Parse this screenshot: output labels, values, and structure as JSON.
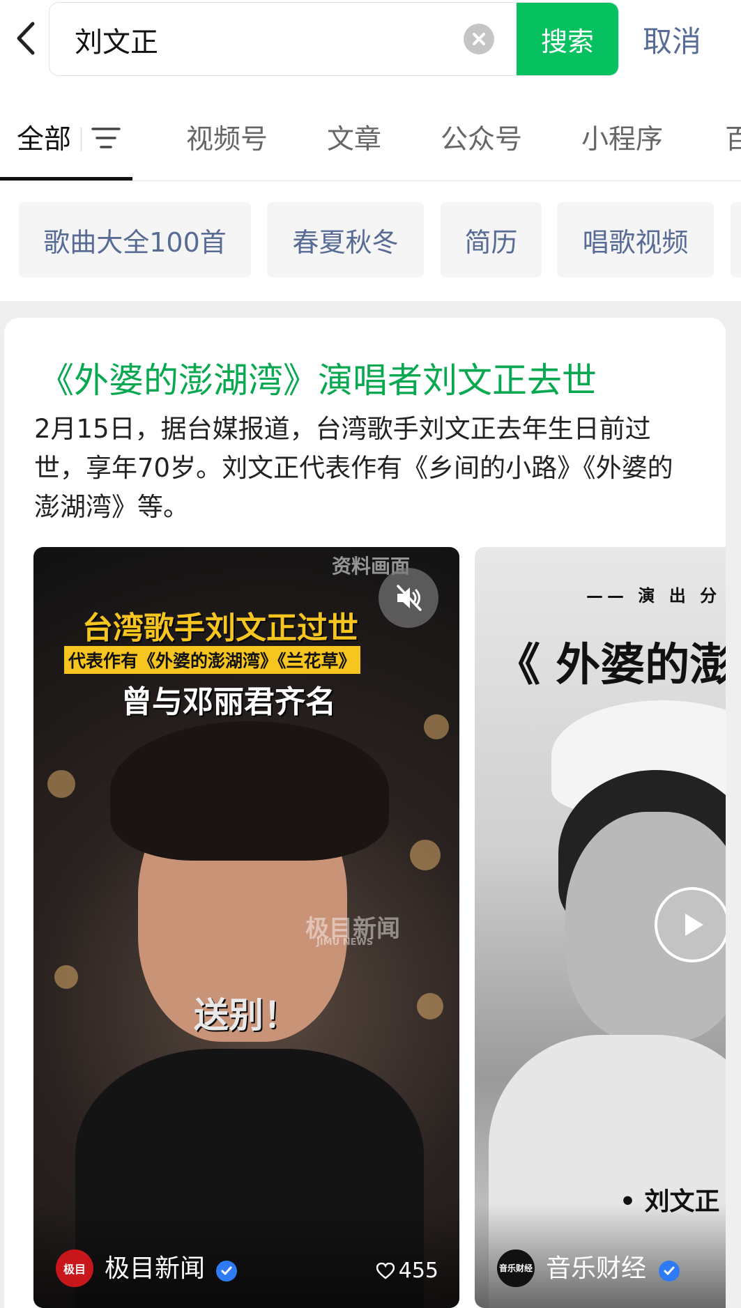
{
  "search": {
    "query": "刘文正",
    "search_button": "搜索",
    "cancel": "取消"
  },
  "tabs": [
    {
      "label": "全部",
      "active": true
    },
    {
      "label": "视频号"
    },
    {
      "label": "文章"
    },
    {
      "label": "公众号"
    },
    {
      "label": "小程序"
    },
    {
      "label": "百"
    }
  ],
  "chips": [
    "歌曲大全100首",
    "春夏秋冬",
    "简历",
    "唱歌视频"
  ],
  "result": {
    "headline": "《外婆的澎湖湾》演唱者刘文正去世",
    "description": "2月15日，据台媒报道，台湾歌手刘文正去年生日前过世，享年70岁。刘文正代表作有《乡间的小路》《外婆的澎湖湾》等。"
  },
  "videos": [
    {
      "corner_label": "资料画面",
      "title": "台湾歌手刘文正过世",
      "banner": "代表作有《外婆的澎湖湾》《兰花草》",
      "subtitle": "曾与邓丽君齐名",
      "caption": "送别！",
      "watermark": "极目新闻",
      "watermark_en": "JIMU NEWS",
      "source_logo": "极目",
      "source": "极目新闻",
      "likes": "455"
    },
    {
      "top_text": "—— 演 出 分",
      "title": "《 外婆的澎",
      "name_tag": "• 刘文正",
      "source_logo": "音乐财经",
      "source": "音乐财经"
    }
  ],
  "colors": {
    "brand_green": "#07c160",
    "headline_green": "#07a84f",
    "link_blue": "#576b95",
    "verified_blue": "#2f7bf5"
  }
}
